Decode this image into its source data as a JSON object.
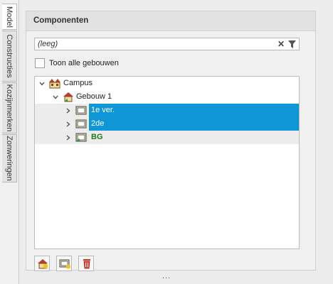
{
  "side_tabs": [
    {
      "label": "Model",
      "active": true
    },
    {
      "label": "Constructies",
      "active": false
    },
    {
      "label": "Kozijnmerken",
      "active": false
    },
    {
      "label": "Zonweringen",
      "active": false
    }
  ],
  "panel": {
    "title": "Componenten",
    "search": {
      "value": "(leeg)"
    },
    "show_all_label": "Toon alle gebouwen",
    "show_all_checked": false
  },
  "tree": {
    "campus": "Campus",
    "building": "Gebouw 1",
    "floors": [
      "1e ver.",
      "2de",
      "BG"
    ]
  },
  "colors": {
    "selection": "#0f96d6",
    "active_floor_text": "#1b7a1b"
  },
  "toolbar_icons": [
    "add-building-icon",
    "add-floor-icon",
    "delete-icon"
  ],
  "footer_grip": "..."
}
